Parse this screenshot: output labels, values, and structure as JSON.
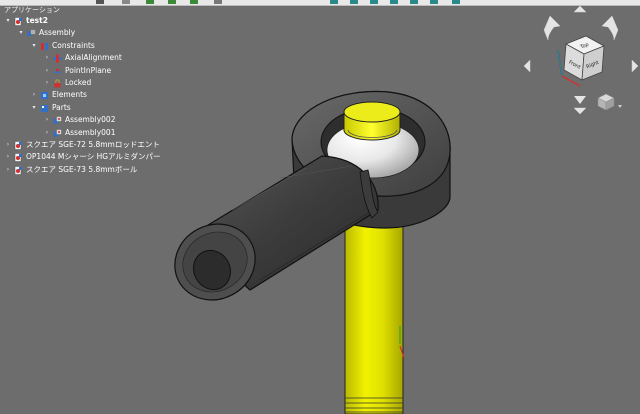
{
  "tree": {
    "header": "アプリケーション",
    "items": [
      {
        "label": "test2",
        "level": 0,
        "expanded": true,
        "icon": "document-icon",
        "bold": true
      },
      {
        "label": "Assembly",
        "level": 1,
        "expanded": true,
        "icon": "assembly-icon"
      },
      {
        "label": "Constraints",
        "level": 2,
        "expanded": true,
        "icon": "constraints-icon"
      },
      {
        "label": "AxialAlignment",
        "level": 3,
        "expanded": false,
        "icon": "constraint-axial-icon"
      },
      {
        "label": "PointInPlane",
        "level": 3,
        "expanded": false,
        "icon": "constraint-point-icon"
      },
      {
        "label": "Locked",
        "level": 3,
        "expanded": false,
        "icon": "constraint-locked-icon"
      },
      {
        "label": "Elements",
        "level": 2,
        "expanded": false,
        "icon": "elements-icon"
      },
      {
        "label": "Parts",
        "level": 2,
        "expanded": true,
        "icon": "parts-icon"
      },
      {
        "label": "Assembly002",
        "level": 3,
        "expanded": false,
        "icon": "subassembly-icon"
      },
      {
        "label": "Assembly001",
        "level": 3,
        "expanded": false,
        "icon": "subassembly-icon"
      },
      {
        "label": "スクエア SGE-72 5.8mmロッドエント",
        "level": 0,
        "expanded": false,
        "icon": "document-icon"
      },
      {
        "label": "OP1044 Mシャーシ HGアルミダンパー",
        "level": 0,
        "expanded": false,
        "icon": "document-icon"
      },
      {
        "label": "スクエア SGE-73 5.8mmボール",
        "level": 0,
        "expanded": false,
        "icon": "document-icon"
      }
    ]
  },
  "navcube": {
    "top": "Top",
    "front": "Front",
    "right": "Right"
  },
  "colors": {
    "background": "#6d6d6d",
    "part_gray": "#4a4a4a",
    "part_yellow": "#e6e600",
    "tree_text": "#ffffff",
    "constraint_red": "#d03030",
    "part_blue": "#3070c8"
  }
}
